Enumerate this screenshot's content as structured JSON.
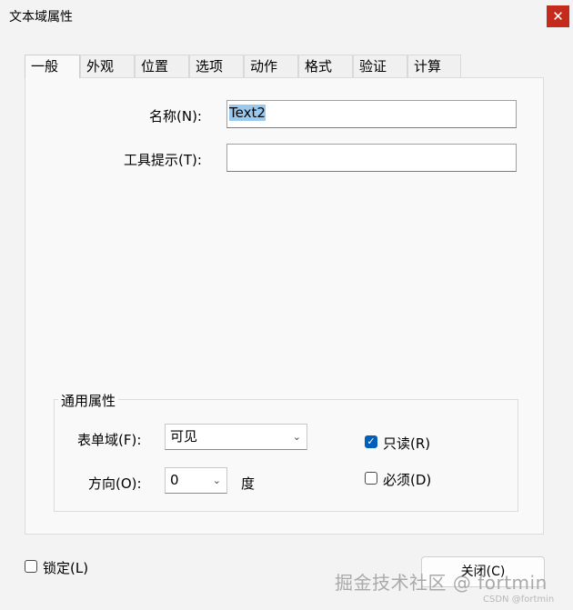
{
  "window": {
    "title": "文本域属性",
    "close_icon": "✕"
  },
  "tabs": [
    {
      "label": "一般"
    },
    {
      "label": "外观"
    },
    {
      "label": "位置"
    },
    {
      "label": "选项"
    },
    {
      "label": "动作"
    },
    {
      "label": "格式"
    },
    {
      "label": "验证"
    },
    {
      "label": "计算"
    }
  ],
  "general": {
    "name_label": "名称(N):",
    "name_value": "Text2",
    "tooltip_label": "工具提示(T):",
    "tooltip_value": ""
  },
  "common": {
    "title": "通用属性",
    "form_field_label": "表单域(F):",
    "form_field_value": "可见",
    "orientation_label": "方向(O):",
    "orientation_value": "0",
    "degree_label": "度",
    "readonly_label": "只读(R)",
    "readonly_checked": true,
    "required_label": "必须(D)",
    "required_checked": false
  },
  "footer": {
    "locked_label": "锁定(L)",
    "locked_checked": false,
    "close_button": "关闭(C)"
  },
  "watermark": {
    "main": "掘金技术社区 @ fortmin",
    "sub": "CSDN @fortmin"
  }
}
